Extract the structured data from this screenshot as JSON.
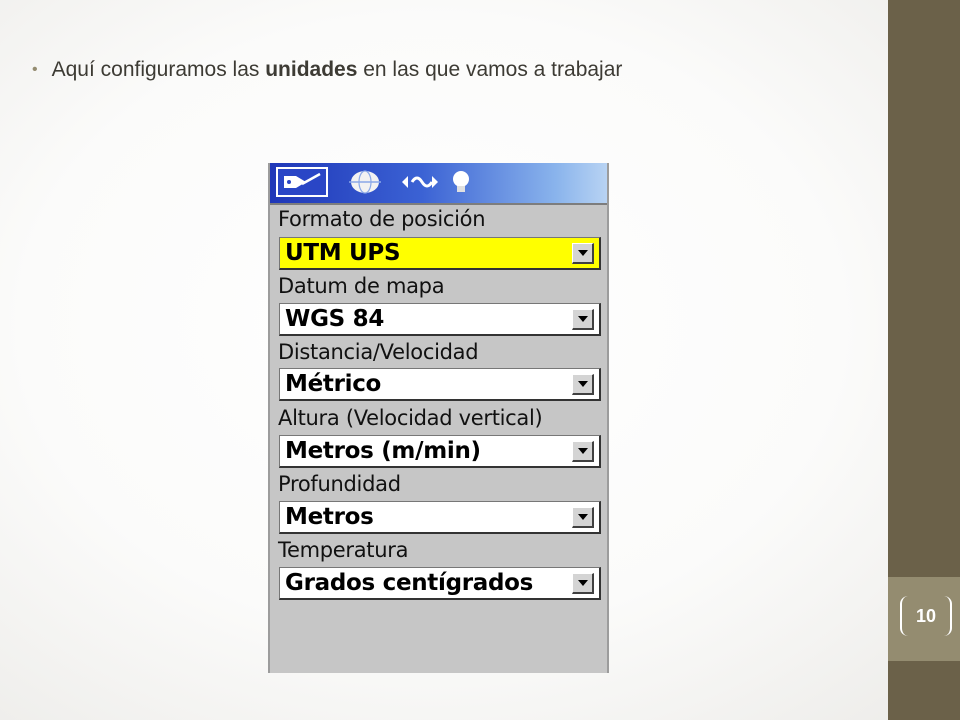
{
  "slide": {
    "bullet": {
      "text_before": "Aquí configuramos las ",
      "text_bold": "unidades",
      "text_after": " en las que vamos a trabajar"
    },
    "page_number": "10"
  },
  "gps_screen": {
    "tabs": [
      {
        "icon": "satellite-dish-icon",
        "active": true
      },
      {
        "icon": "globe-icon",
        "active": false
      },
      {
        "icon": "signal-wave-icon",
        "active": false
      },
      {
        "icon": "lightbulb-icon",
        "active": false
      }
    ],
    "fields": [
      {
        "label": "Formato de posición",
        "value": "UTM UPS",
        "selected": true
      },
      {
        "label": "Datum de mapa",
        "value": "WGS 84",
        "selected": false
      },
      {
        "label": "Distancia/Velocidad",
        "value": "Métrico",
        "selected": false
      },
      {
        "label": "Altura (Velocidad vertical)",
        "value": "Metros (m/min)",
        "selected": false
      },
      {
        "label": "Profundidad",
        "value": "Metros",
        "selected": false
      },
      {
        "label": "Temperatura",
        "value": "Grados centígrados",
        "selected": false
      }
    ],
    "colors": {
      "selected_field": "#ffff00",
      "tab_bar_start": "#1f37b8",
      "tab_bar_end": "#b8d3f3",
      "screen_bg": "#c6c6c6"
    }
  },
  "theme": {
    "side_band": "#6b6149",
    "page_box": "#948c70"
  }
}
